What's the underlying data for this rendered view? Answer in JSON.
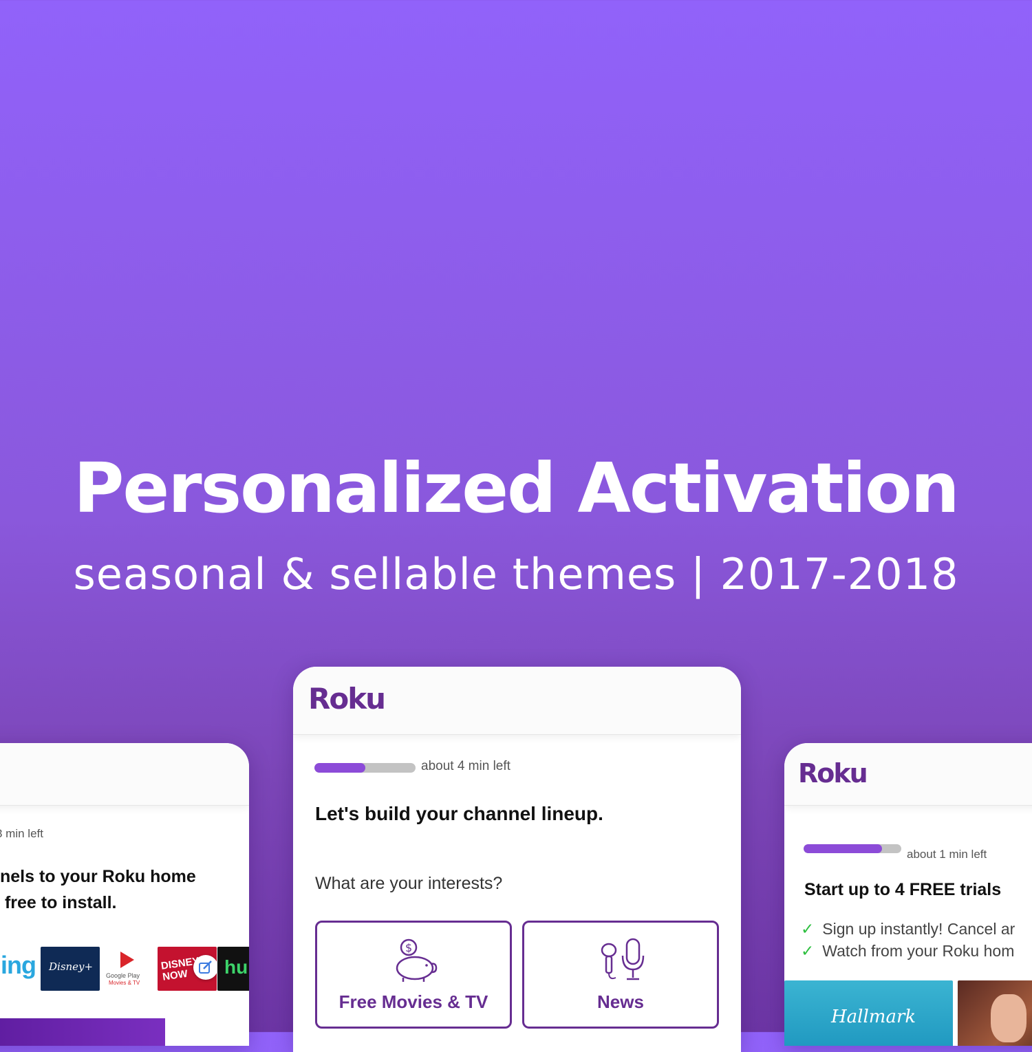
{
  "hero": {
    "title": "Personalized Activation",
    "subtitle": "seasonal & sellable themes | 2017-2018"
  },
  "colors": {
    "brand_purple": "#662d91",
    "progress_fill": "#8c4bd8",
    "check_green": "#2cbf3e"
  },
  "left_card": {
    "time_left": "3 min left",
    "heading_line1": "nels to your Roku home",
    "heading_line2": " free to install.",
    "tiles": {
      "sling": "ling",
      "disney_plus": "Disney+",
      "google_play_line1": "Google Play",
      "google_play_line2": "Movies & TV",
      "disney_now": "DISNEY NOW",
      "hulu": "hu"
    }
  },
  "center_card": {
    "logo": "Roku",
    "progress": 0.5,
    "time_left": "about 4 min left",
    "heading": "Let's build your channel lineup.",
    "question": "What are your interests?",
    "options": [
      {
        "label": "Free Movies & TV",
        "icon": "piggy-bank-icon"
      },
      {
        "label": "News",
        "icon": "microphone-icon"
      }
    ]
  },
  "right_card": {
    "logo": "Roku",
    "progress": 0.8,
    "time_left": "about 1 min left",
    "heading": "Start up to 4 FREE trials",
    "benefits": [
      "Sign up instantly! Cancel ar",
      "Watch from your Roku hom"
    ],
    "tiles": {
      "hallmark": "Hallmark"
    }
  }
}
